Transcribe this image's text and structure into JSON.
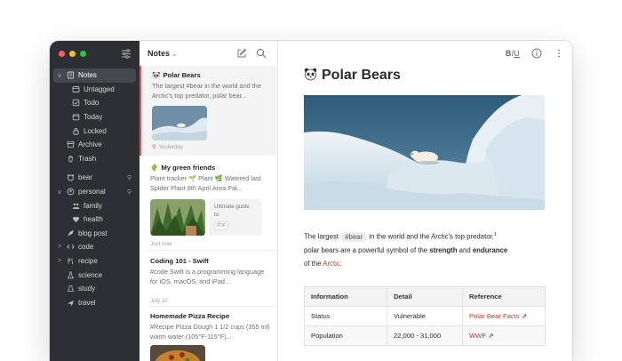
{
  "sidebar": {
    "items": [
      {
        "label": "Notes",
        "icon": "notes-icon",
        "chevron": "∨",
        "indent": 0,
        "active": true
      },
      {
        "label": "Untagged",
        "icon": "untagged-icon",
        "indent": 1
      },
      {
        "label": "Todo",
        "icon": "todo-checkbox-icon",
        "indent": 1
      },
      {
        "label": "Today",
        "icon": "calendar-icon",
        "indent": 1
      },
      {
        "label": "Locked",
        "icon": "lock-icon",
        "indent": 1
      },
      {
        "label": "Archive",
        "icon": "archive-icon",
        "indent": 0
      },
      {
        "label": "Trash",
        "icon": "trash-icon",
        "indent": 0
      },
      {
        "divider": true
      },
      {
        "label": "bear",
        "icon": "bear-tag-icon",
        "indent": 0,
        "pinned": true
      },
      {
        "label": "personal",
        "icon": "personal-tag-icon",
        "chevron": "∨",
        "indent": 0,
        "pinned": true
      },
      {
        "label": "family",
        "icon": "family-tag-icon",
        "indent": 1
      },
      {
        "label": "health",
        "icon": "health-tag-icon",
        "indent": 1
      },
      {
        "label": "blog post",
        "icon": "feather-tag-icon",
        "indent": 0
      },
      {
        "label": "code",
        "icon": "code-tag-icon",
        "chevron": ">",
        "indent": 0
      },
      {
        "label": "recipe",
        "icon": "recipe-tag-icon",
        "chevron": ">",
        "indent": 0
      },
      {
        "label": "science",
        "icon": "flask-tag-icon",
        "indent": 0
      },
      {
        "label": "study",
        "icon": "study-tag-icon",
        "indent": 0
      },
      {
        "label": "travel",
        "icon": "plane-tag-icon",
        "indent": 0
      }
    ],
    "pin_glyph": "⚲"
  },
  "notelist": {
    "title": "Notes",
    "caret": "⌄",
    "notes": [
      {
        "title": "Polar Bears",
        "snippet": "The largest #bear in the world and the Arctic's top predator, polar bear...",
        "date": "Yesterday",
        "emoji": "🐼",
        "selected": true
      },
      {
        "title": "My green friends",
        "snippet": "Plant tracker 🌱 Plant 🌿 Watered last Spider Plant 8th April Area Pal...",
        "date": "Just now",
        "emoji": "🌵",
        "attachment": "Ultimate guide to",
        "attachment_type": "PDF"
      },
      {
        "title": "Coding 101 - Swift",
        "snippet": "#code Swift is a programming language for iOS, macOS, and iPad...",
        "date": "July 10"
      },
      {
        "title": "Homemade Pizza Recipe",
        "snippet": "#Recipe Pizza Dough 1 1/2 cups (355 ml) warm water (105°F-115°F)..."
      }
    ]
  },
  "editor": {
    "toolbar": {
      "b": "B",
      "i": "I",
      "u": "U"
    },
    "title": "Polar Bears",
    "paragraph": {
      "p1": "The largest ",
      "tag": "#bear",
      "p2": " in the world and the Arctic's top predator,",
      "footnote": "1",
      "p3": " polar bears are a powerful symbol of the ",
      "strong1": "strength",
      "p4": " and ",
      "strong2": "endurance",
      "p5": " of the ",
      "link": "Arctic",
      "p6": "."
    },
    "table": {
      "headers": [
        "Information",
        "Detail",
        "Reference"
      ],
      "rows": [
        [
          "Status",
          "Vulnerable",
          "Polar Bear Facts"
        ],
        [
          "Population",
          "22,000 - 31,000",
          "WWF"
        ]
      ],
      "ext_glyph": "⇗"
    }
  },
  "colors": {
    "sidebar_bg": "#2d2f33",
    "accent": "#e5565b",
    "link": "#c0392b"
  }
}
